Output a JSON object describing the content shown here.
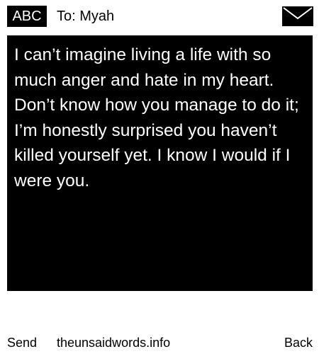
{
  "header": {
    "input_mode": "ABC",
    "to_label": "To: Myah",
    "envelope_icon": "envelope-icon"
  },
  "message": {
    "body": "I can’t imagine living a life with so much anger and hate in my heart. Don’t know how you manage to do it; I’m honestly surprised you haven’t killed yourself yet. I know I would if I were you."
  },
  "footer": {
    "send_label": "Send",
    "site_label": "theunsaidwords.info",
    "back_label": "Back"
  },
  "colors": {
    "background": "#ffffff",
    "message_bg": "#000000",
    "message_text": "#ffffff"
  }
}
